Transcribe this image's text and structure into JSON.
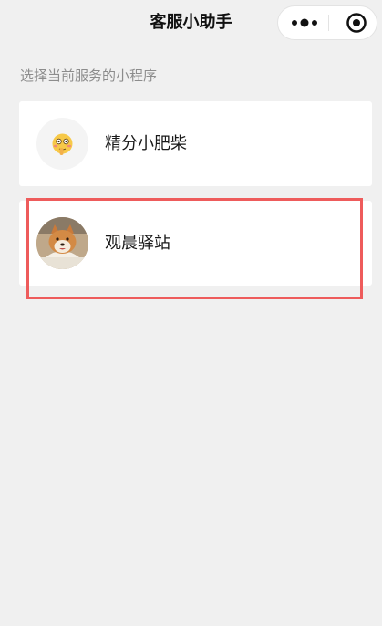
{
  "header": {
    "title": "客服小助手",
    "capsule": {
      "menu_icon": "more-dots-icon",
      "close_icon": "target-close-icon"
    }
  },
  "section": {
    "label": "选择当前服务的小程序"
  },
  "list": [
    {
      "name": "精分小肥柴",
      "avatar_icon": "flushed-face-emoji-icon"
    },
    {
      "name": "观晨驿站",
      "avatar_icon": "shiba-dog-photo"
    }
  ],
  "colors": {
    "background": "#f0f0f0",
    "card": "#ffffff",
    "highlight": "#ee5b5b"
  }
}
